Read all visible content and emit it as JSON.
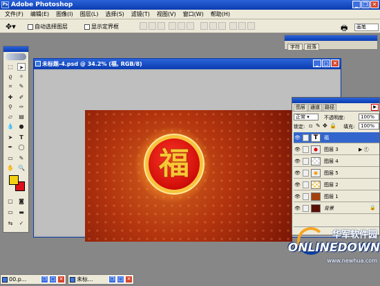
{
  "app": {
    "title": "Adobe Photoshop",
    "logo_text": "Ps"
  },
  "menubar": [
    "文件(F)",
    "编辑(E)",
    "图像(I)",
    "图层(L)",
    "选择(S)",
    "滤镜(T)",
    "视图(V)",
    "窗口(W)",
    "帮助(H)"
  ],
  "options_bar": {
    "auto_select_label": "自动选择图层",
    "show_bounds_label": "显示定界框"
  },
  "palette_well": {
    "tabs": [
      "字符",
      "段落"
    ],
    "right_tab": "画笔"
  },
  "document": {
    "title": "未标题-4.psd @ 34.2% (福, RGB/8)",
    "art_glyph": "福"
  },
  "colors": {
    "foreground": "#f3d016",
    "background": "#e0101a",
    "selection": "#3266cc"
  },
  "layers_panel": {
    "tabs": [
      "图层",
      "通道",
      "路径"
    ],
    "blend_mode": "正常",
    "opacity_label": "不透明度:",
    "opacity_value": "100%",
    "lock_label": "锁定:",
    "fill_label": "填充:",
    "fill_value": "100%",
    "layers": [
      {
        "name": "福",
        "thumb": "T",
        "selected": true
      },
      {
        "name": "图层 3",
        "thumb": "red-dot",
        "fx": true
      },
      {
        "name": "图层 4",
        "thumb": "checker"
      },
      {
        "name": "图层 5",
        "thumb": "orange-dot"
      },
      {
        "name": "图层 2",
        "thumb": "checker-yellow"
      },
      {
        "name": "图层 1",
        "thumb": "brown"
      },
      {
        "name": "背景",
        "thumb": "dark-red",
        "locked": true
      }
    ]
  },
  "taskbar": [
    {
      "label": "00.p..."
    },
    {
      "label": "未标..."
    }
  ],
  "watermark": {
    "cn": "华军软件园",
    "en": "ONLINEDOWN",
    "url": "www.newhua.com"
  }
}
